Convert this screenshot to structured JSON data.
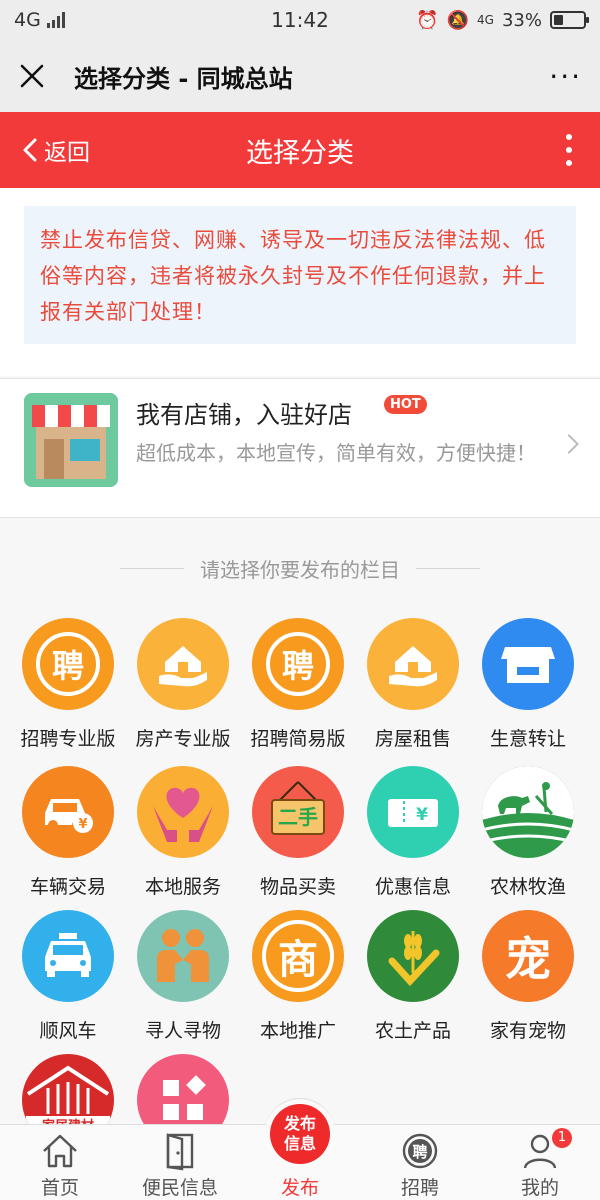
{
  "status_bar": {
    "network": "4G",
    "time": "11:42",
    "network_right": "4G",
    "battery": "33%",
    "battery_level": 0.33
  },
  "wechat_bar": {
    "title": "选择分类 - 同城总站",
    "more": "···"
  },
  "header": {
    "back_label": "返回",
    "title": "选择分类"
  },
  "notice": {
    "text": "禁止发布信贷、网赚、诱导及一切违反法律法规、低俗等内容，违者将被永久封号及不作任何退款，并上报有关部门处理！"
  },
  "shop_banner": {
    "title": "我有店铺，入驻好店",
    "badge": "HOT",
    "description": "超低成本，本地宣传，简单有效，方便快捷！"
  },
  "section_label": "请选择你要发布的栏目",
  "categories": [
    {
      "label": "招聘专业版",
      "icon": "hire-icon",
      "color": "#f79a1e"
    },
    {
      "label": "房产专业版",
      "icon": "house-hand-icon",
      "color": "#fbb23a"
    },
    {
      "label": "招聘简易版",
      "icon": "hire-icon",
      "color": "#f79a1e"
    },
    {
      "label": "房屋租售",
      "icon": "house-hand-icon",
      "color": "#fbb23a"
    },
    {
      "label": "生意转让",
      "icon": "storefront-icon",
      "color": "#2f8bef"
    },
    {
      "label": "车辆交易",
      "icon": "car-money-icon",
      "color": "#f5851f"
    },
    {
      "label": "本地服务",
      "icon": "heart-hands-icon",
      "color": "#fbae34"
    },
    {
      "label": "物品买卖",
      "icon": "secondhand-sign-icon",
      "color": "#f45b4a"
    },
    {
      "label": "优惠信息",
      "icon": "coupon-icon",
      "color": "#2fcfb2"
    },
    {
      "label": "农林牧渔",
      "icon": "farming-icon",
      "color": "#2f9a4a"
    },
    {
      "label": "顺风车",
      "icon": "taxi-icon",
      "color": "#32b0ec"
    },
    {
      "label": "寻人寻物",
      "icon": "people-icon",
      "color": "#7fc4b2"
    },
    {
      "label": "本地推广",
      "icon": "shang-icon",
      "color": "#f79a1e"
    },
    {
      "label": "农土产品",
      "icon": "wheat-icon",
      "color": "#2f8a3a"
    },
    {
      "label": "家有宠物",
      "icon": "pet-icon",
      "color": "#f57a2a"
    },
    {
      "label": "",
      "icon": "furniture-icon",
      "color": "#d62a2a",
      "text": "家居建材"
    },
    {
      "label": "",
      "icon": "grid-icon",
      "color": "#f25b7c"
    }
  ],
  "tab_bar": {
    "items": [
      {
        "label": "首页",
        "icon": "home-icon"
      },
      {
        "label": "便民信息",
        "icon": "door-icon"
      },
      {
        "label": "发布",
        "icon": "publish-icon",
        "button_text": "发布信息"
      },
      {
        "label": "招聘",
        "icon": "hire-icon"
      },
      {
        "label": "我的",
        "icon": "user-icon",
        "badge": "1"
      }
    ]
  }
}
